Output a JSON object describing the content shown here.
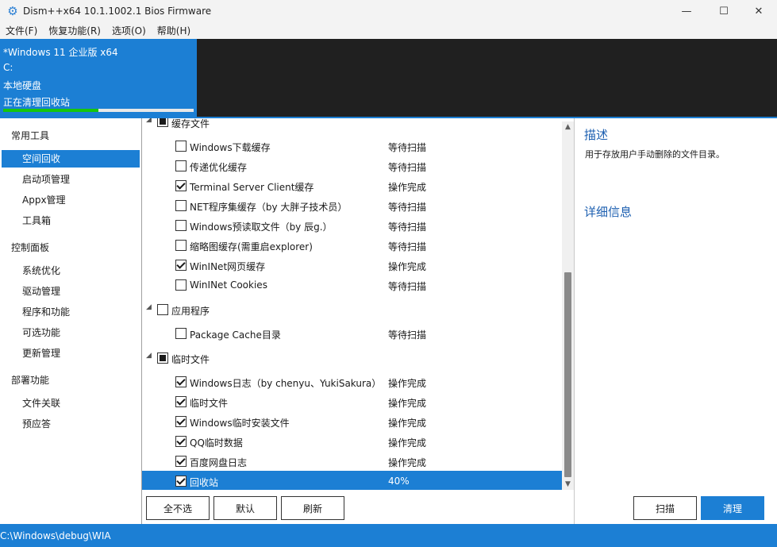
{
  "window": {
    "title": "Dism++x64 10.1.1002.1 Bios Firmware",
    "minimize_glyph": "—",
    "maximize_glyph": "☐",
    "close_glyph": "✕"
  },
  "menu": [
    "文件(F)",
    "恢复功能(R)",
    "选项(O)",
    "帮助(H)"
  ],
  "os_panel": {
    "edition": "*Windows 11 企业版 x64",
    "drive": "C:",
    "disk": "本地硬盘",
    "task": "正在清理回收站",
    "progress_percent": 50
  },
  "sidebar": {
    "groups": [
      {
        "label": "常用工具",
        "items": [
          "空间回收",
          "启动项管理",
          "Appx管理",
          "工具箱"
        ]
      },
      {
        "label": "控制面板",
        "items": [
          "系统优化",
          "驱动管理",
          "程序和功能",
          "可选功能",
          "更新管理"
        ]
      },
      {
        "label": "部署功能",
        "items": [
          "文件关联",
          "预应答"
        ]
      }
    ],
    "selected": "空间回收"
  },
  "tree": {
    "groups": [
      {
        "label": "缓存文件",
        "state": "partial",
        "children": [
          {
            "name": "Windows下载缓存",
            "checked": false,
            "status": "等待扫描"
          },
          {
            "name": "传递优化缓存",
            "checked": false,
            "status": "等待扫描"
          },
          {
            "name": "Terminal Server Client缓存",
            "checked": true,
            "status": "操作完成"
          },
          {
            "name": "NET程序集缓存（by 大胖子技术员）",
            "checked": false,
            "status": "等待扫描"
          },
          {
            "name": "Windows预读取文件（by 辰g.）",
            "checked": false,
            "status": "等待扫描"
          },
          {
            "name": "缩略图缓存(需重启explorer)",
            "checked": false,
            "status": "等待扫描"
          },
          {
            "name": "WinINet网页缓存",
            "checked": true,
            "status": "操作完成"
          },
          {
            "name": "WinINet Cookies",
            "checked": false,
            "status": "等待扫描"
          }
        ]
      },
      {
        "label": "应用程序",
        "state": "unchecked",
        "children": [
          {
            "name": "Package Cache目录",
            "checked": false,
            "status": "等待扫描"
          }
        ]
      },
      {
        "label": "临时文件",
        "state": "partial",
        "children": [
          {
            "name": "Windows日志（by chenyu、YukiSakura）",
            "checked": true,
            "status": "操作完成"
          },
          {
            "name": "临时文件",
            "checked": true,
            "status": "操作完成"
          },
          {
            "name": "Windows临时安装文件",
            "checked": true,
            "status": "操作完成"
          },
          {
            "name": "QQ临时数据",
            "checked": true,
            "status": "操作完成"
          },
          {
            "name": "百度网盘日志",
            "checked": true,
            "status": "操作完成"
          },
          {
            "name": "回收站",
            "checked": true,
            "status": "40%",
            "selected": true
          }
        ]
      }
    ]
  },
  "description": {
    "heading": "描述",
    "text": "用于存放用户手动删除的文件目录。",
    "details_heading": "详细信息"
  },
  "buttons": {
    "deselect_all": "全不选",
    "default": "默认",
    "refresh": "刷新",
    "scan": "扫描",
    "clean": "清理"
  },
  "statusbar": {
    "path": "C:\\Windows\\debug\\WIA"
  },
  "colors": {
    "accent": "#1c7fd4",
    "progress": "#16c60c",
    "dark": "#202020",
    "heading": "#1c5fb0"
  }
}
